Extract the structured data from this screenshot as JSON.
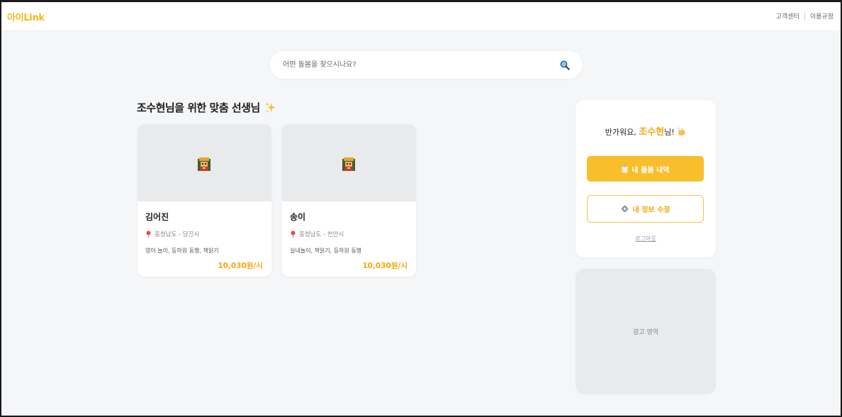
{
  "header": {
    "logo": "아이Link",
    "links": [
      "고객센터",
      "이용규정"
    ]
  },
  "search": {
    "placeholder": "어떤 돌봄을 찾으시나요?"
  },
  "section": {
    "title": "조수현님을 위한 맞춤 선생님"
  },
  "teachers": [
    {
      "name": "김어진",
      "location": "충청남도 - 당진시",
      "tags": "영어 놀이, 등하원 동행, 책읽기",
      "price": "10,030원/시"
    },
    {
      "name": "송이",
      "location": "충청남도 - 천안시",
      "tags": "실내놀이, 책읽기, 등하원 동행",
      "price": "10,030원/시"
    }
  ],
  "welcome": {
    "greeting_prefix": "반가워요, ",
    "user_name": "조수현",
    "greeting_suffix": "님!",
    "primary_button": "내 돌봄 내역",
    "secondary_button": "내 정보 수정",
    "logout": "로그아웃"
  },
  "ad": {
    "label": "광고 영역"
  },
  "colors": {
    "accent": "#f9be2c",
    "accent_text": "#f5a70e",
    "background": "#f5f6f8"
  }
}
